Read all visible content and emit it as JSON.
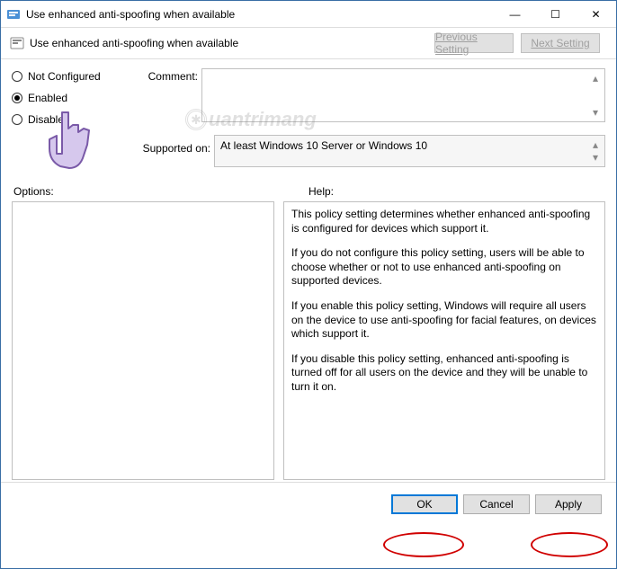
{
  "window": {
    "title": "Use enhanced anti-spoofing when available",
    "minimize": "—",
    "maximize": "☐",
    "close": "✕"
  },
  "header": {
    "title": "Use enhanced anti-spoofing when available",
    "prev": "Previous Setting",
    "next": "Next Setting"
  },
  "states": {
    "not_configured": "Not Configured",
    "enabled": "Enabled",
    "disabled": "Disabled",
    "selected": "enabled"
  },
  "fields": {
    "comment_label": "Comment:",
    "supported_label": "Supported on:",
    "supported_value": "At least Windows 10 Server or Windows 10"
  },
  "panels": {
    "options_label": "Options:",
    "help_label": "Help:",
    "help_p1": "This policy setting determines whether enhanced anti-spoofing is configured for devices which support it.",
    "help_p2": "If you do not configure this policy setting, users will be able to choose whether or not to use enhanced anti-spoofing on supported devices.",
    "help_p3": "If you enable this policy setting, Windows will require all users on the device to use anti-spoofing for facial features, on devices which support it.",
    "help_p4": "If you disable this policy setting, enhanced anti-spoofing is turned off for all users on the device and they will be unable to turn it on."
  },
  "buttons": {
    "ok": "OK",
    "cancel": "Cancel",
    "apply": "Apply"
  },
  "watermark": {
    "text": "uantrimang"
  }
}
